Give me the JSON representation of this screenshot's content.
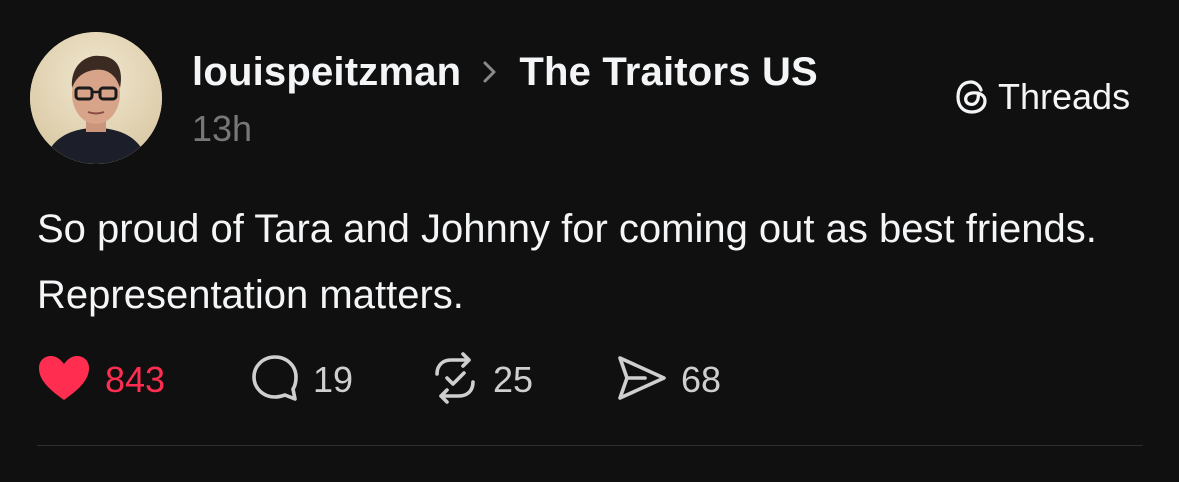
{
  "post": {
    "author": "louispeitzman",
    "community": "The Traitors US",
    "timestamp": "13h",
    "platform_label": "Threads",
    "text": "So proud of Tara and Johnny for coming out as best friends. Representation matters."
  },
  "actions": {
    "likes": "843",
    "replies": "19",
    "reposts": "25",
    "shares": "68"
  },
  "icons": {
    "like": "heart-icon",
    "reply": "comment-bubble-icon",
    "repost": "repost-icon",
    "share": "share-send-icon",
    "separator": "chevron-right-icon",
    "brand": "threads-logo-icon"
  },
  "colors": {
    "background": "#101010",
    "text_primary": "#f3f5f7",
    "text_secondary": "#777777",
    "like_accent": "#ff2e50"
  }
}
